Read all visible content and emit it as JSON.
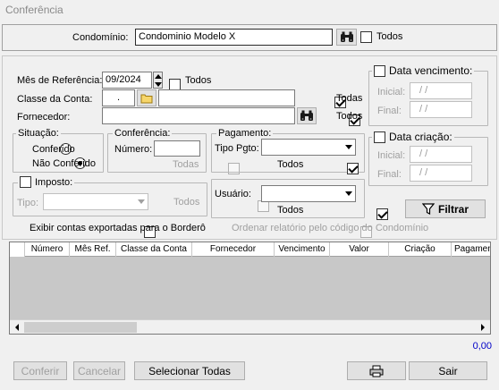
{
  "window": {
    "title": "Conferência"
  },
  "condominio": {
    "label": "Condomínio:",
    "value": "Condominio Modelo X",
    "todos_label": "Todos",
    "todos_checked": false
  },
  "filters": {
    "mes_referencia": {
      "label": "Mês de Referência:",
      "value": "09/2024",
      "todos_label": "Todos",
      "todos_checked": false
    },
    "classe_conta": {
      "label": "Classe da Conta:",
      "code": ".",
      "description": "",
      "todos_label": "Todas",
      "todos_checked": true
    },
    "fornecedor": {
      "label": "Fornecedor:",
      "value": "",
      "todos_label": "Todos",
      "todos_checked": true
    },
    "data_vencimento": {
      "label": "Data vencimento:",
      "checked": false,
      "inicial_label": "Inicial:",
      "inicial_value": "/ /",
      "final_label": "Final:",
      "final_value": "/ /"
    },
    "data_criacao": {
      "label": "Data criação:",
      "checked": false,
      "inicial_label": "Inicial:",
      "inicial_value": "/ /",
      "final_label": "Final:",
      "final_value": "/ /"
    },
    "situacao": {
      "legend": "Situação:",
      "options": [
        "Conferido",
        "Não Conferido"
      ],
      "selected": "Não Conferido"
    },
    "conferencia": {
      "legend": "Conferência:",
      "numero_label": "Número:",
      "numero_value": "",
      "todas_label": "Todas",
      "todas_checked": false
    },
    "pagamento": {
      "legend": "Pagamento:",
      "tipo_label": "Tipo Pgto:",
      "tipo_value": "",
      "todos_label": "Todos",
      "todos_checked": true
    },
    "imposto": {
      "legend": "Imposto:",
      "checked": false,
      "tipo_label": "Tipo:",
      "tipo_value": "",
      "todos_label": "Todos",
      "todos_checked": false
    },
    "usuario": {
      "label": "Usuário:",
      "value": "",
      "todos_label": "Todos",
      "todos_checked": true
    },
    "filtrar_label": "Filtrar",
    "exibir_exportadas": {
      "label": "Exibir contas exportadas para o Borderô",
      "checked": false
    },
    "ordenar_codigo": {
      "label": "Ordenar relatório pelo código do Condomínio",
      "checked": false
    }
  },
  "grid": {
    "columns": [
      "Número",
      "Mês Ref.",
      "Classe da Conta",
      "Fornecedor",
      "Vencimento",
      "Valor",
      "Criação",
      "Pagament"
    ],
    "rows": []
  },
  "total": "0,00",
  "buttons": {
    "conferir": "Conferir",
    "cancelar": "Cancelar",
    "selecionar_todas": "Selecionar Todas",
    "sair": "Sair"
  },
  "icons": {
    "binoculars": "binoculars-icon",
    "folder": "folder-icon",
    "funnel": "funnel-icon",
    "printer": "printer-icon"
  }
}
